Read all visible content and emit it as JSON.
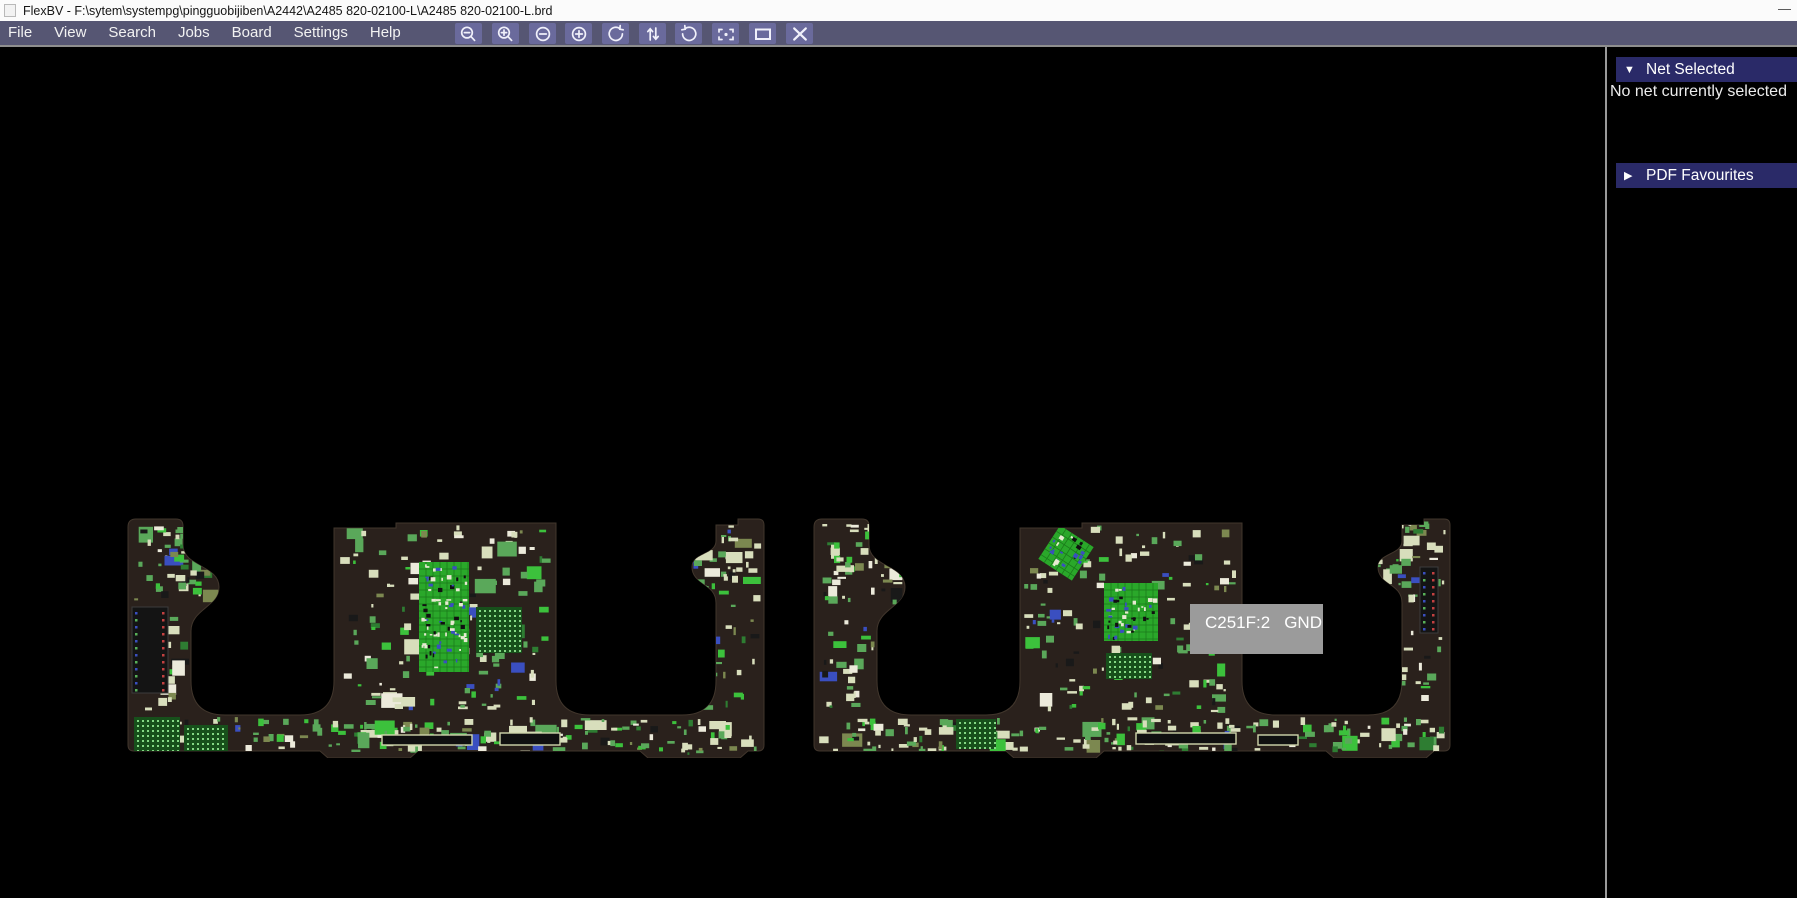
{
  "window": {
    "title": "FlexBV - F:\\sytem\\systempg\\pingguobijiben\\A2442\\A2485 820-02100-L\\A2485 820-02100-L.brd",
    "minimize_glyph": "—"
  },
  "menu": {
    "items": [
      "File",
      "View",
      "Search",
      "Jobs",
      "Board",
      "Settings",
      "Help"
    ]
  },
  "toolbar": {
    "buttons": [
      {
        "name": "zoom-out-lens",
        "icon": "magnifier-minus-icon"
      },
      {
        "name": "zoom-in-lens",
        "icon": "magnifier-plus-icon"
      },
      {
        "name": "zoom-out",
        "icon": "circle-minus-icon"
      },
      {
        "name": "zoom-in",
        "icon": "circle-plus-icon"
      },
      {
        "name": "rotate-ccw",
        "icon": "rotate-ccw-icon"
      },
      {
        "name": "flip-board",
        "icon": "flip-vertical-icon"
      },
      {
        "name": "rotate-cw",
        "icon": "rotate-cw-icon"
      },
      {
        "name": "zoom-fit",
        "icon": "center-fit-icon"
      },
      {
        "name": "window-mode",
        "icon": "rectangle-icon"
      },
      {
        "name": "close-view",
        "icon": "close-icon"
      }
    ]
  },
  "viewer": {
    "boards": [
      {
        "side": "top"
      },
      {
        "side": "bottom"
      }
    ],
    "tooltip": {
      "component_ref": "C251F:2",
      "net": "GND"
    }
  },
  "sidebar": {
    "panels": [
      {
        "label": "Net Selected",
        "state": "expanded",
        "triangle": "▼",
        "body": "No net currently selected"
      },
      {
        "label": "PDF Favourites",
        "state": "collapsed",
        "triangle": "▶",
        "body": ""
      }
    ]
  },
  "colors": {
    "menubar": "#565673",
    "toolbar_button": "#6a6a9c",
    "panel_header": "#2a2a68",
    "tooltip_bg": "#9b9b9b",
    "board_substrate": "#2a211c",
    "board_edge": "#41362c",
    "component_cream": "#d8debc",
    "component_green": "#5aa85a",
    "component_bright_green": "#3cc13c",
    "component_blue": "#3a4fc0"
  }
}
